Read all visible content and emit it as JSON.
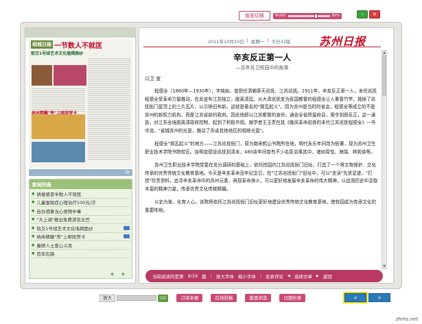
{
  "topbar": {
    "layout_label": "版面切换",
    "music_label": "MUSIC",
    "music_pct": 0.62,
    "music_suffix": "60%"
  },
  "window": {
    "minimize": "–",
    "close": "×"
  },
  "thumb": {
    "logo": "相城日报",
    "headline": "一节数人不就匡",
    "subhead": "软交1号线艺术文化墙揭面纱",
    "sub2": "纳米精雕\"秀\"上邮政贺卡"
  },
  "newslist": {
    "header": "新闻列表",
    "items": [
      {
        "label": "锈楼感冒半数人不就医",
        "video": false
      },
      {
        "label": "儿童蛋抛症心理治疗100元/次",
        "video": false
      },
      {
        "label": "自办酒宴当心食物中毒",
        "video": false
      },
      {
        "label": "\"大上湖\"推出免费游览太巴",
        "video": false
      },
      {
        "label": "轨交1号线艺术文化墙揭面纱",
        "video": true
      },
      {
        "label": "纳米精雕\"秀\"上邮政贺卡",
        "video": true
      },
      {
        "label": "藤牌人士爱心义卖",
        "video": false
      },
      {
        "label": "百年石路",
        "video": false
      }
    ],
    "pager": "◆ ◆"
  },
  "page": {
    "date": "2011年10月10日",
    "weekday": "星期一",
    "pages": "今日32版",
    "masthead": "苏州日报"
  },
  "article": {
    "title": "辛亥反正第一人",
    "subtitle": "—百年苏卫校园中的故事",
    "author": "口卫 宣",
    "paragraphs": [
      "程德全（1860年—1930年），字纯如。曾担任清朝奉天巡抚、江苏巡抚。1911年，辛亥反正第一人，末任巡抚程德全受革命力量推动，在此宣布江苏独立，脱离清廷。从大清巡抚变为民国都督的程德全让人拿着竹竿，挑掉了巡抚衙门屋顶上的三片瓦片，以示除旧布新，这就是著名的\"揭瓦起义\"。因为苏州是当时的省会，程德全等成立的不是苏州的新权力机构，而是江苏省新的政府。因此他即以江苏都督的身份，通告全省所属府县，限令到即反正，这一通告，对江苏全境脱离清政府控制，起到了积极作用。据学者王玉贵在其《晚风革命前夜的末代江苏巡抚程德全》一书中说，\"省城苏州的光复，推动了苏省其他地区的相继光复\"。",
      "程德全\"揭瓦起义\"的地方——江苏巡抚衙门，原为南宋鹤山书院所在地，明代永乐年间改为衙署，现为苏州卫生职业技术学院书院校区。自明宣德设巡抚到清末，480余年间曾有不少名臣治事其中，诸如周忱、海瑞、林则徐等。",
      "苏州卫生职业技术学院党委在充分调研的基础上，依托校园内江苏巡抚衙门旧址，打造了一个将文物保护、文化传承的优秀传统文化教育基地。今天是辛亥革命百年纪念日，在\"江苏巡抚衙门\"旧址中，可以\"走读\"先贤足迹，\"打捞\"珍贵资料，追寻辛亥革命中的苏州元素，再现革命烽火，可以更好地发展辛亥革命的伟大精神，以追溯历史中汲取丰富的精神力量，传承优秀文化传统精髓。",
      "以史为鉴，化育人心。该院将依托江苏巡抚衙门旧址更好地建设优秀传统文化教育基地，使校园成为传承文化的重要阵地。"
    ]
  },
  "readbar": {
    "current_label": "当前阅读的是第",
    "current_value": "9/19",
    "page_unit": "篇",
    "zoom_in": "放大字体",
    "zoom_out": "缩小字体",
    "send": "发表评论",
    "prev": "选择文章",
    "back": "返回"
  },
  "bottombar": {
    "zoom_label": "放大",
    "zoom_go": "GO",
    "buttons": [
      "订阅本报",
      "在线投稿",
      "版面浏览",
      "日期检索"
    ],
    "prev": "«",
    "next": "»"
  },
  "watermark": "zhms.net"
}
